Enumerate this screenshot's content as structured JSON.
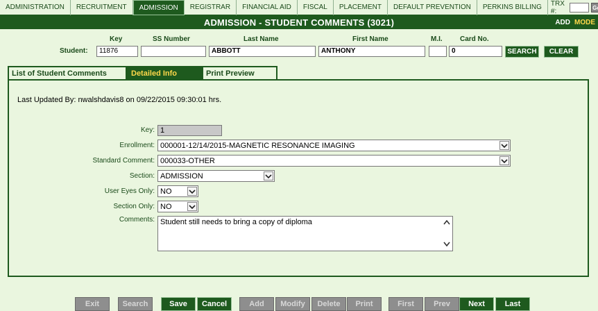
{
  "nav": {
    "items": [
      {
        "label": "ADMINISTRATION",
        "active": false
      },
      {
        "label": "RECRUITMENT",
        "active": false
      },
      {
        "label": "ADMISSION",
        "active": true
      },
      {
        "label": "REGISTRAR",
        "active": false
      },
      {
        "label": "FINANCIAL AID",
        "active": false
      },
      {
        "label": "FISCAL",
        "active": false
      },
      {
        "label": "PLACEMENT",
        "active": false
      },
      {
        "label": "DEFAULT PREVENTION",
        "active": false
      },
      {
        "label": "PERKINS BILLING",
        "active": false
      }
    ],
    "trx_label": "TRX #:",
    "trx_value": "",
    "go_label": "Go!"
  },
  "title": {
    "text": "ADMISSION - STUDENT COMMENTS (3021)",
    "mode_add": "ADD",
    "mode_label": "MODE"
  },
  "student": {
    "row_label": "Student:",
    "headers": {
      "key": "Key",
      "ssn": "SS Number",
      "last": "Last Name",
      "first": "First Name",
      "mi": "M.I.",
      "card": "Card No."
    },
    "values": {
      "key": "11876",
      "ssn": "",
      "last": "ABBOTT",
      "first": "ANTHONY",
      "mi": "",
      "card": "0"
    },
    "search_label": "SEARCH",
    "clear_label": "CLEAR"
  },
  "tabs": [
    {
      "label": "List of Student Comments",
      "active": false
    },
    {
      "label": "Detailed Info",
      "active": true
    },
    {
      "label": "Print Preview",
      "active": false
    }
  ],
  "detail": {
    "last_updated": "Last Updated By: nwalshdavis8 on 09/22/2015 09:30:01 hrs.",
    "key_label": "Key:",
    "key_value": "1",
    "enrollment_label": "Enrollment:",
    "enrollment_value": "000001-12/14/2015-MAGNETIC RESONANCE IMAGING",
    "standard_comment_label": "Standard Comment:",
    "standard_comment_value": "000033-OTHER",
    "section_label": "Section:",
    "section_value": "ADMISSION",
    "user_eyes_label": "User Eyes Only:",
    "user_eyes_value": "NO",
    "section_only_label": "Section Only:",
    "section_only_value": "NO",
    "comments_label": "Comments:",
    "comments_value": "Student still needs to bring a copy of diploma"
  },
  "toolbar": {
    "buttons": [
      {
        "label": "Exit",
        "enabled": false
      },
      {
        "label": "Search",
        "enabled": false
      },
      {
        "label": "Save",
        "enabled": true
      },
      {
        "label": "Cancel",
        "enabled": true
      },
      {
        "label": "Add",
        "enabled": false
      },
      {
        "label": "Modify",
        "enabled": false
      },
      {
        "label": "Delete",
        "enabled": false
      },
      {
        "label": "Print",
        "enabled": false
      },
      {
        "label": "First",
        "enabled": false
      },
      {
        "label": "Prev",
        "enabled": false
      },
      {
        "label": "Next",
        "enabled": true
      },
      {
        "label": "Last",
        "enabled": true
      }
    ]
  },
  "colors": {
    "primary": "#1e5a1e",
    "background": "#eaf6df",
    "highlight": "#ffd84a",
    "disabled": "#8e8e8e"
  }
}
